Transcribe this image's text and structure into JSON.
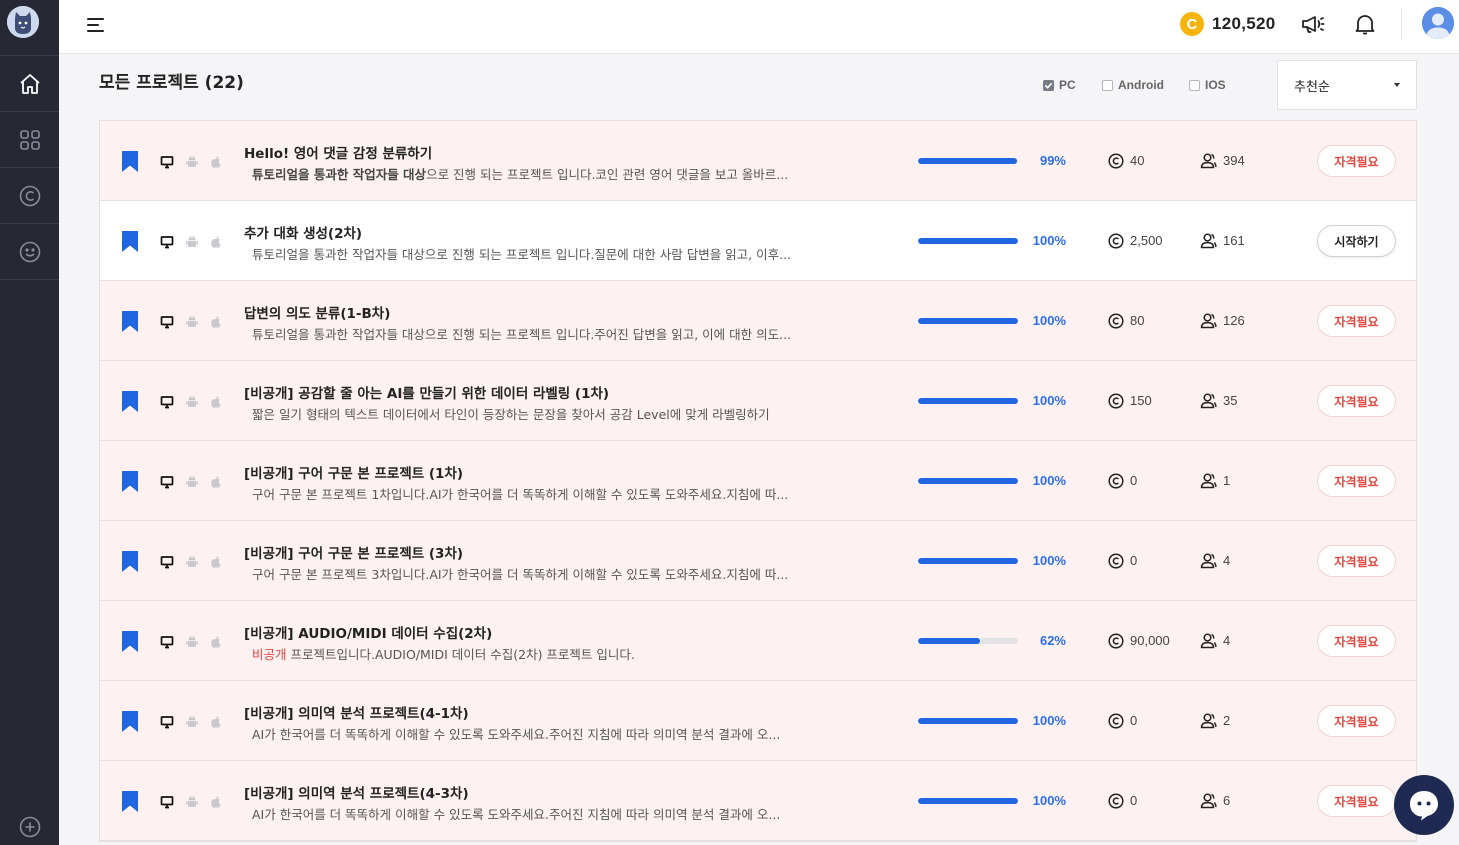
{
  "header": {
    "coin_symbol": "C",
    "coin_balance": "120,520"
  },
  "toolbar": {
    "title": "모든 프로젝트 (22)",
    "filters": [
      {
        "label": "PC",
        "checked": true
      },
      {
        "label": "Android",
        "checked": false
      },
      {
        "label": "IOS",
        "checked": false
      }
    ],
    "sort": "추천순"
  },
  "projects": [
    {
      "title": "Hello! 영어 댓글 감정 분류하기",
      "desc_bold": "튜토리얼을 통과한 작업자들 대상",
      "desc": "으로 진행 되는 프로젝트 입니다.코인 관련 영어 댓글을 보고 올바르...",
      "desc_prefix": "",
      "progress": 99,
      "progress_label": "99%",
      "reward": "40",
      "participants": "394",
      "action": "자격필요",
      "bg": "pink"
    },
    {
      "title": "추가 대화 생성(2차)",
      "desc_bold": "",
      "desc": "튜토리얼을 통과한 작업자들 대상으로 진행 되는 프로젝트 입니다.질문에 대한 사람 답변을 읽고, 이후...",
      "desc_prefix": "",
      "progress": 100,
      "progress_label": "100%",
      "reward": "2,500",
      "participants": "161",
      "action": "시작하기",
      "bg": "white"
    },
    {
      "title": "답변의 의도 분류(1-B차)",
      "desc_bold": "",
      "desc": "튜토리얼을 통과한 작업자들 대상으로 진행 되는 프로젝트 입니다.주어진 답변을 읽고, 이에 대한 의도...",
      "desc_prefix": "",
      "progress": 100,
      "progress_label": "100%",
      "reward": "80",
      "participants": "126",
      "action": "자격필요",
      "bg": "pink"
    },
    {
      "title": "[비공개] 공감할 줄 아는 AI를 만들기 위한 데이터 라벨링 (1차)",
      "desc_bold": "",
      "desc": "짧은 일기 형태의 텍스트 데이터에서 타인이 등장하는 문장을 찾아서 공감 Level에 맞게 라벨링하기",
      "desc_prefix": "",
      "progress": 100,
      "progress_label": "100%",
      "reward": "150",
      "participants": "35",
      "action": "자격필요",
      "bg": "pink"
    },
    {
      "title": "[비공개] 구어 구문 본 프로젝트 (1차)",
      "desc_bold": "",
      "desc": "구어 구문 본 프로젝트 1차입니다.AI가 한국어를 더 똑똑하게 이해할 수 있도록 도와주세요.지침에 따...",
      "desc_prefix": "",
      "progress": 100,
      "progress_label": "100%",
      "reward": "0",
      "participants": "1",
      "action": "자격필요",
      "bg": "pink"
    },
    {
      "title": "[비공개] 구어 구문 본 프로젝트 (3차)",
      "desc_bold": "",
      "desc": "구어 구문 본 프로젝트 3차입니다.AI가 한국어를 더 똑똑하게 이해할 수 있도록 도와주세요.지침에 따...",
      "desc_prefix": "",
      "progress": 100,
      "progress_label": "100%",
      "reward": "0",
      "participants": "4",
      "action": "자격필요",
      "bg": "pink"
    },
    {
      "title": "[비공개] AUDIO/MIDI 데이터 수집(2차)",
      "desc_bold": "",
      "desc": " 프로젝트입니다.AUDIO/MIDI 데이터 수집(2차) 프로젝트 입니다.",
      "desc_prefix": "비공개",
      "progress": 62,
      "progress_label": "62%",
      "reward": "90,000",
      "participants": "4",
      "action": "자격필요",
      "bg": "pink"
    },
    {
      "title": "[비공개] 의미역 분석 프로젝트(4-1차)",
      "desc_bold": "",
      "desc": "AI가 한국어를 더 똑똑하게 이해할 수 있도록 도와주세요.주어진 지침에 따라 의미역 분석 결과에 오...",
      "desc_prefix": "",
      "progress": 100,
      "progress_label": "100%",
      "reward": "0",
      "participants": "2",
      "action": "자격필요",
      "bg": "pink"
    },
    {
      "title": "[비공개] 의미역 분석 프로젝트(4-3차)",
      "desc_bold": "",
      "desc": "AI가 한국어를 더 똑똑하게 이해할 수 있도록 도와주세요.주어진 지침에 따라 의미역 분석 결과에 오...",
      "desc_prefix": "",
      "progress": 100,
      "progress_label": "100%",
      "reward": "0",
      "participants": "6",
      "action": "자격필요",
      "bg": "pink"
    }
  ],
  "icons": {
    "sidebar": [
      "logo-icon",
      "home-icon",
      "grid-icon",
      "coin-circle-icon",
      "smile-icon",
      "plus-circle-icon"
    ],
    "header": [
      "hamburger-icon",
      "megaphone-icon",
      "bell-icon",
      "avatar-icon"
    ],
    "row": [
      "bookmark-icon",
      "monitor-icon",
      "android-icon",
      "apple-icon",
      "coin-outline-icon",
      "people-icon"
    ],
    "chat": "chat-bubble-icon"
  },
  "colors": {
    "sidebar_bg": "#262833",
    "accent_blue": "#1f66e0",
    "warning_red": "#e8453c",
    "row_pink": "#fdf1f1",
    "coin_gold": "#f6b40e",
    "chat_bg": "#1f2a52"
  }
}
